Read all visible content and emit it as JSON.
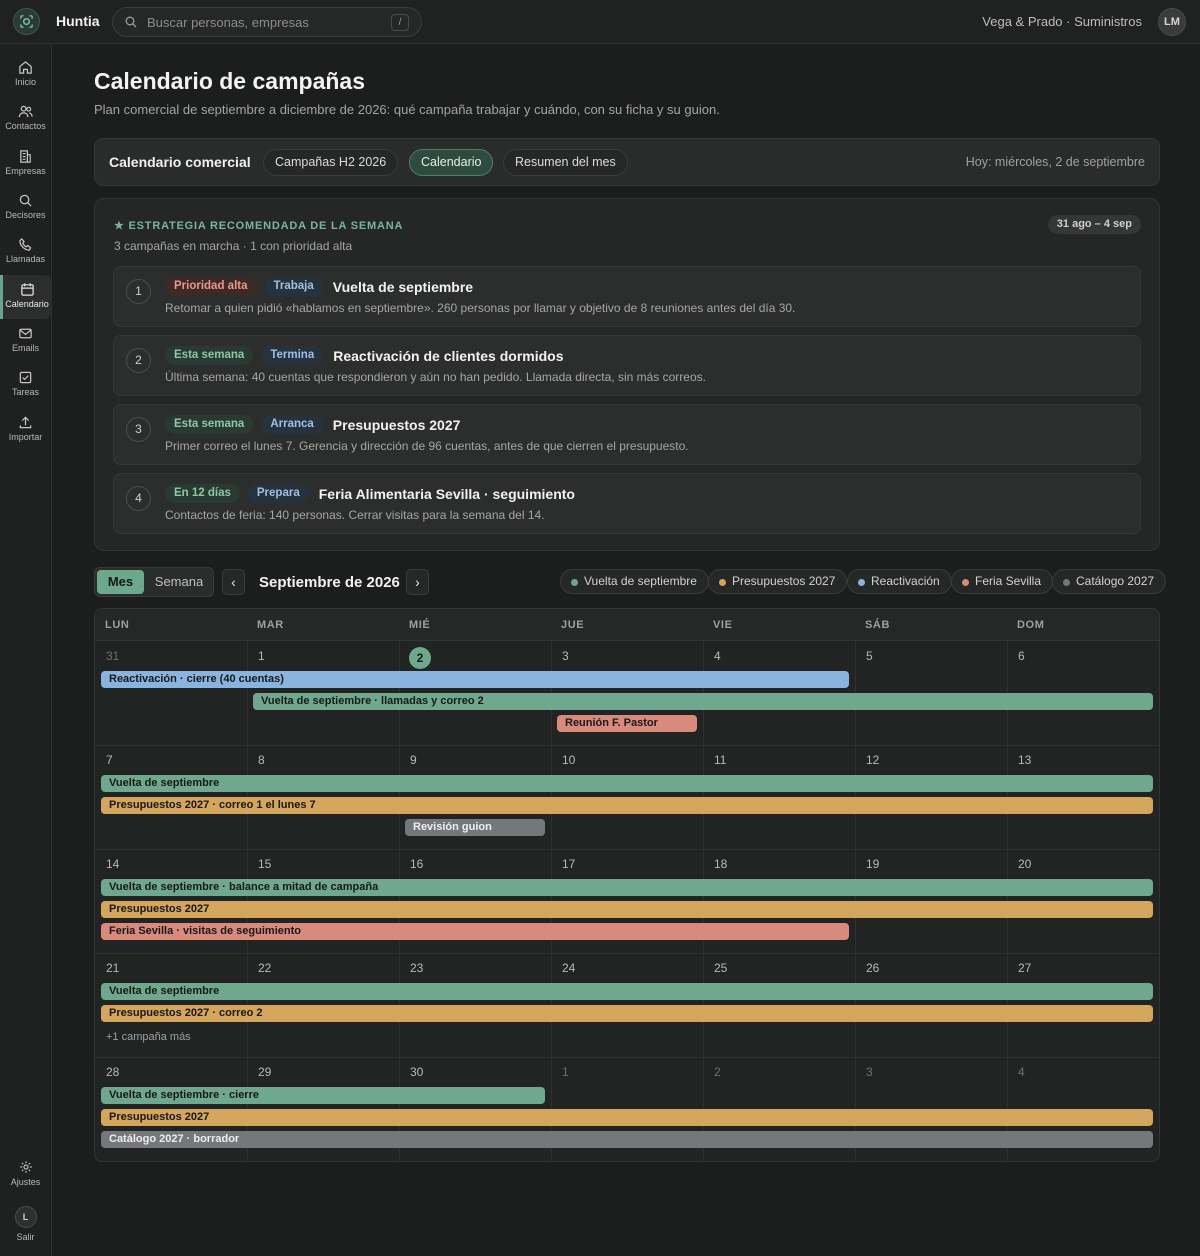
{
  "app": {
    "name": "Huntia",
    "company": "Vega & Prado · Suministros",
    "avatar_initials": "LM"
  },
  "search": {
    "placeholder": "Buscar personas, empresas",
    "shortcut": "/"
  },
  "sidebar": {
    "items": [
      {
        "label": "Inicio",
        "icon": "home-icon"
      },
      {
        "label": "Contactos",
        "icon": "users-icon"
      },
      {
        "label": "Empresas",
        "icon": "building-icon"
      },
      {
        "label": "Decisores",
        "icon": "search-icon"
      },
      {
        "label": "Llamadas",
        "icon": "phone-icon"
      },
      {
        "label": "Calendario",
        "icon": "calendar-icon",
        "active": true
      },
      {
        "label": "Emails",
        "icon": "mail-icon"
      },
      {
        "label": "Tareas",
        "icon": "check-square-icon"
      },
      {
        "label": "Importar",
        "icon": "upload-icon"
      }
    ],
    "settings_label": "Ajustes",
    "logout_label": "Salir",
    "logout_initial": "L"
  },
  "page": {
    "title": "Calendario de campañas",
    "subtitle": "Plan comercial de septiembre a diciembre de 2026: qué campaña trabajar y cuándo, con su ficha y su guion."
  },
  "toolbar": {
    "title": "Calendario comercial",
    "tabs": [
      "Campañas H2 2026",
      "Calendario",
      "Resumen del mes"
    ],
    "active_tab": "Calendario",
    "today": "Hoy: miércoles, 2 de septiembre"
  },
  "strategy": {
    "kicker": "ESTRATEGIA RECOMENDADA DE LA SEMANA",
    "meta": "3 campañas en marcha · 1 con prioridad alta",
    "range": "31 ago – 4 sep",
    "cards": [
      {
        "num": "1",
        "tag1": "Prioridad alta",
        "tag2": "Trabaja",
        "title": "Vuelta de septiembre",
        "desc": "Retomar a quien pidió «hablamos en septiembre». 260 personas por llamar y objetivo de 8 reuniones antes del día 30."
      },
      {
        "num": "2",
        "tag1": "Esta semana",
        "tag2": "Termina",
        "title": "Reactivación de clientes dormidos",
        "desc": "Última semana: 40 cuentas que respondieron y aún no han pedido. Llamada directa, sin más correos."
      },
      {
        "num": "3",
        "tag1": "Esta semana",
        "tag2": "Arranca",
        "title": "Presupuestos 2027",
        "desc": "Primer correo el lunes 7. Gerencia y dirección de 96 cuentas, antes de que cierren el presupuesto."
      },
      {
        "num": "4",
        "tag1": "En 12 días",
        "tag2": "Prepara",
        "title": "Feria Alimentaria Sevilla · seguimiento",
        "desc": "Contactos de feria: 140 personas. Cerrar visitas para la semana del 14."
      }
    ]
  },
  "calendar": {
    "view_month": "Mes",
    "view_week": "Semana",
    "prev": "‹",
    "next": "›",
    "month_title": "Septiembre de 2026",
    "legend": [
      {
        "label": "Vuelta de septiembre",
        "color": "#6fa88e"
      },
      {
        "label": "Presupuestos 2027",
        "color": "#d4a55c"
      },
      {
        "label": "Reactivación",
        "color": "#8ab4e0"
      },
      {
        "label": "Feria Sevilla",
        "color": "#d88a7c"
      },
      {
        "label": "Catálogo 2027",
        "color": "#75777a"
      }
    ],
    "weekdays": [
      "LUN",
      "MAR",
      "MIÉ",
      "JUE",
      "VIE",
      "SÁB",
      "DOM"
    ],
    "weeks": [
      {
        "days": [
          "31",
          "1",
          "2",
          "3",
          "4",
          "5",
          "6"
        ],
        "events": [
          {
            "label": "Reactivación · cierre (40 cuentas)",
            "start": 0,
            "span": 5,
            "lane": 0,
            "color": "#8ab4e0"
          },
          {
            "label": "Vuelta de septiembre · llamadas y correo 2",
            "start": 1,
            "span": 6,
            "lane": 1,
            "color": "#6fa88e"
          },
          {
            "label": "Reunión F. Pastor",
            "start": 3,
            "span": 1,
            "lane": 2,
            "color": "#d88a7c"
          }
        ]
      },
      {
        "days": [
          "7",
          "8",
          "9",
          "10",
          "11",
          "12",
          "13"
        ],
        "events": [
          {
            "label": "Vuelta de septiembre",
            "start": 0,
            "span": 7,
            "lane": 0,
            "color": "#6fa88e"
          },
          {
            "label": "Presupuestos 2027 · correo 1 el lunes 7",
            "start": 0,
            "span": 7,
            "lane": 1,
            "color": "#d4a55c"
          },
          {
            "label": "Revisión guion",
            "start": 2,
            "span": 1,
            "lane": 2,
            "color": "#75777a",
            "light": true
          }
        ]
      },
      {
        "days": [
          "14",
          "15",
          "16",
          "17",
          "18",
          "19",
          "20"
        ],
        "events": [
          {
            "label": "Vuelta de septiembre · balance a mitad de campaña",
            "start": 0,
            "span": 7,
            "lane": 0,
            "color": "#6fa88e"
          },
          {
            "label": "Presupuestos 2027",
            "start": 0,
            "span": 7,
            "lane": 1,
            "color": "#d4a55c"
          },
          {
            "label": "Feria Sevilla · visitas de seguimiento",
            "start": 0,
            "span": 5,
            "lane": 2,
            "color": "#d88a7c"
          }
        ]
      },
      {
        "days": [
          "21",
          "22",
          "23",
          "24",
          "25",
          "26",
          "27"
        ],
        "events": [
          {
            "label": "Vuelta de septiembre",
            "start": 0,
            "span": 7,
            "lane": 0,
            "color": "#6fa88e"
          },
          {
            "label": "Presupuestos 2027 · correo 2",
            "start": 0,
            "span": 7,
            "lane": 1,
            "color": "#d4a55c"
          }
        ],
        "more": "+1 campaña más"
      },
      {
        "days": [
          "28",
          "29",
          "30",
          "1",
          "2",
          "3",
          "4"
        ],
        "events": [
          {
            "label": "Vuelta de septiembre · cierre",
            "start": 0,
            "span": 3,
            "lane": 0,
            "color": "#6fa88e"
          },
          {
            "label": "Presupuestos 2027",
            "start": 0,
            "span": 7,
            "lane": 1,
            "color": "#d4a55c"
          },
          {
            "label": "Catálogo 2027 · borrador",
            "start": 0,
            "span": 7,
            "lane": 2,
            "color": "#75777a",
            "light": true
          }
        ]
      }
    ],
    "muted_days": [
      [
        0,
        0
      ],
      [
        4,
        3
      ],
      [
        4,
        4
      ],
      [
        4,
        5
      ],
      [
        4,
        6
      ]
    ],
    "today": [
      0,
      2
    ]
  }
}
